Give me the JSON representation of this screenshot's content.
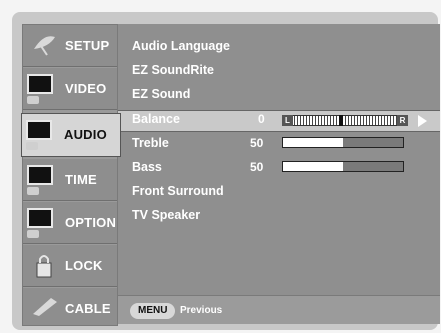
{
  "sidebar": {
    "items": [
      {
        "label": "SETUP",
        "icon": "satellite-dish-icon"
      },
      {
        "label": "VIDEO",
        "icon": "tv-screen-icon"
      },
      {
        "label": "AUDIO",
        "icon": "tv-screen-icon",
        "active": true
      },
      {
        "label": "TIME",
        "icon": "tv-screen-icon"
      },
      {
        "label": "OPTION",
        "icon": "tv-screen-icon"
      },
      {
        "label": "LOCK",
        "icon": "padlock-icon"
      },
      {
        "label": "CABLE",
        "icon": "cable-icon"
      }
    ]
  },
  "audio_menu": {
    "audio_language": "Audio Language",
    "ez_soundrite": "EZ SoundRite",
    "ez_sound": "EZ Sound",
    "balance": {
      "label": "Balance",
      "value": "0",
      "left": "L",
      "right": "R"
    },
    "treble": {
      "label": "Treble",
      "value": "50",
      "level": 0.5
    },
    "bass": {
      "label": "Bass",
      "value": "50",
      "level": 0.5
    },
    "front_surround": "Front Surround",
    "tv_speaker": "TV Speaker"
  },
  "footer": {
    "menu_button": "MENU",
    "hint": "Previous"
  }
}
